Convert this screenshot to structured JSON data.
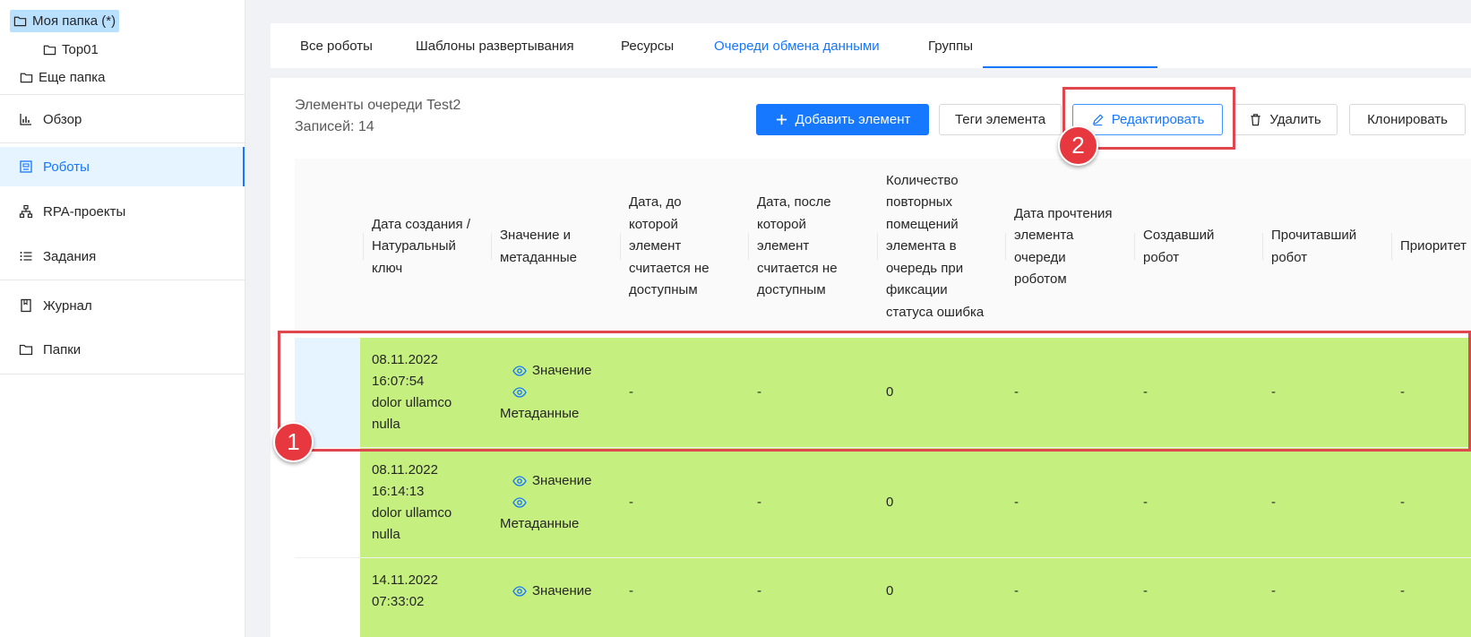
{
  "sidebar": {
    "tree": {
      "my_folder": "Моя папка (*)",
      "top01": "Top01",
      "other_folder": "Еще папка"
    },
    "nav": {
      "overview": "Обзор",
      "robots": "Роботы",
      "rpa_projects": "RPA-проекты",
      "tasks": "Задания",
      "journal": "Журнал",
      "folders": "Папки"
    }
  },
  "tabs": {
    "all_robots": "Все роботы",
    "templates": "Шаблоны развертывания",
    "resources": "Ресурсы",
    "queues": "Очереди обмена данными",
    "groups": "Группы",
    "active": "queues"
  },
  "queue": {
    "title": "Элементы очереди Test2",
    "count": "Записей: 14"
  },
  "toolbar": {
    "add": "Добавить элемент",
    "tags": "Теги элемента",
    "edit": "Редактировать",
    "delete": "Удалить",
    "clone": "Клонировать"
  },
  "annotations": {
    "one": "1",
    "two": "2"
  },
  "table": {
    "columns": {
      "created": [
        "Дата создания /",
        "Натуральный",
        "ключ"
      ],
      "value_meta": [
        "Значение и",
        "метаданные"
      ],
      "date_until": [
        "Дата, до",
        "которой",
        "элемент",
        "считается не",
        "доступным"
      ],
      "date_after": [
        "Дата, после",
        "которой",
        "элемент",
        "считается не",
        "доступным"
      ],
      "retry_count": [
        "Количество",
        "повторных",
        "помещений",
        "элемента в",
        "очередь при",
        "фиксации",
        "статуса ошибка"
      ],
      "read_date": [
        "Дата прочтения",
        "элемента",
        "очереди",
        "роботом"
      ],
      "creator": [
        "Создавший",
        "робот"
      ],
      "reader": [
        "Прочитавший",
        "робот"
      ],
      "priority": [
        "Приоритет"
      ]
    },
    "rows": [
      {
        "created": [
          "08.11.2022",
          "16:07:54",
          "dolor ullamco",
          "nulla"
        ],
        "value_label": "Значение",
        "meta_label": "Метаданные",
        "date_until": "-",
        "date_after": "-",
        "retry_count": "0",
        "read_date": "-",
        "creator": "-",
        "reader": "-",
        "priority": "-"
      },
      {
        "created": [
          "08.11.2022",
          "16:14:13",
          "dolor ullamco",
          "nulla"
        ],
        "value_label": "Значение",
        "meta_label": "Метаданные",
        "date_until": "-",
        "date_after": "-",
        "retry_count": "0",
        "read_date": "-",
        "creator": "-",
        "reader": "-",
        "priority": "-"
      },
      {
        "created": [
          "14.11.2022",
          "07:33:02"
        ],
        "value_label": "Значение",
        "date_until": "-",
        "date_after": "-",
        "retry_count": "0",
        "read_date": "-",
        "creator": "-",
        "reader": "-",
        "priority": "-"
      }
    ]
  },
  "colors": {
    "accent": "#1677ff",
    "row_highlight": "#c5ef7f",
    "annotation": "#e0464e"
  }
}
